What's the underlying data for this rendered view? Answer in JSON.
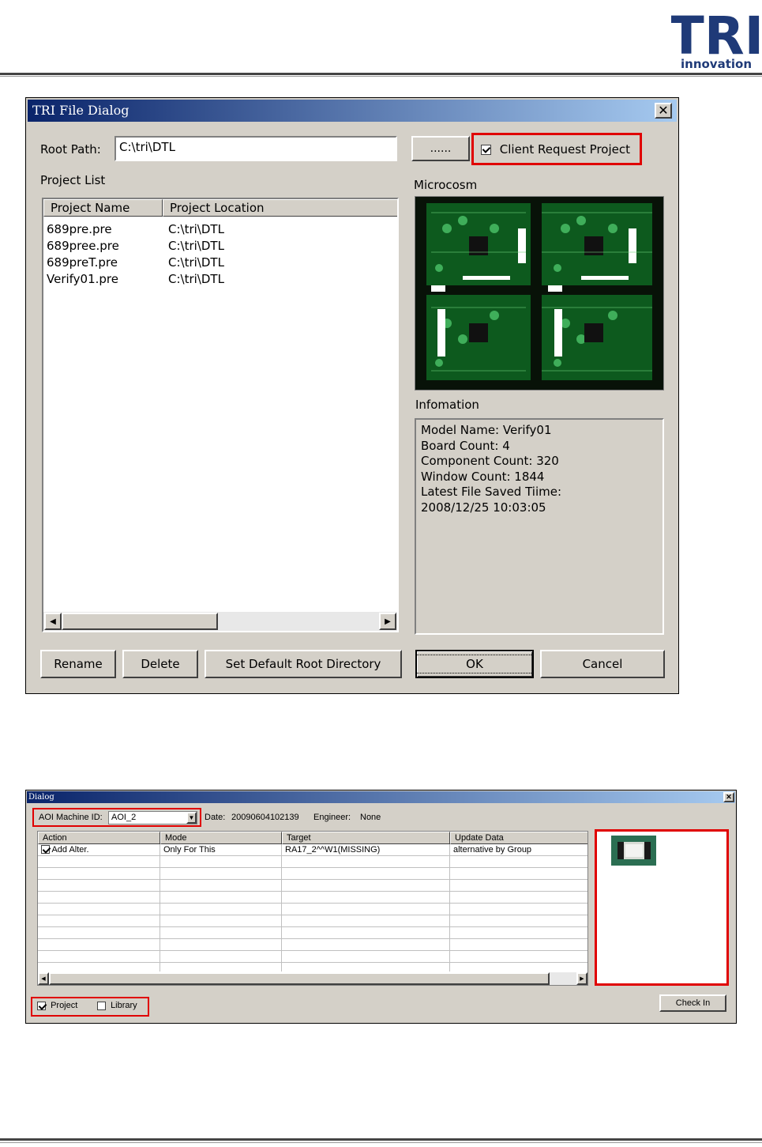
{
  "logo": {
    "main": "TRI",
    "sub": "innovation"
  },
  "dialog1": {
    "title": "TRI File Dialog",
    "root_path_label": "Root Path:",
    "root_path_value": "C:\\tri\\DTL",
    "browse_button": "......",
    "client_request_label": "Client Request Project",
    "client_request_checked": true,
    "project_list_label": "Project List",
    "columns": [
      "Project Name",
      "Project Location"
    ],
    "projects": [
      {
        "name": "689pre.pre",
        "location": "C:\\tri\\DTL"
      },
      {
        "name": "689pree.pre",
        "location": "C:\\tri\\DTL"
      },
      {
        "name": "689preT.pre",
        "location": "C:\\tri\\DTL"
      },
      {
        "name": "Verify01.pre",
        "location": "C:\\tri\\DTL"
      }
    ],
    "microcosm_label": "Microcosm",
    "information_label": "Infomation",
    "information_lines": [
      "Model Name: Verify01",
      "Board Count: 4",
      "Component Count: 320",
      "Window Count: 1844",
      "Latest File Saved Tiime:",
      "2008/12/25  10:03:05"
    ],
    "buttons": {
      "rename": "Rename",
      "delete": "Delete",
      "set_default": "Set Default Root Directory",
      "ok": "OK",
      "cancel": "Cancel"
    }
  },
  "dialog2": {
    "title": "Dialog",
    "aoi_label": "AOI Machine ID:",
    "aoi_value": "AOI_2",
    "date_label": "Date:",
    "date_value": "20090604102139",
    "engineer_label": "Engineer:",
    "engineer_value": "None",
    "columns": [
      "Action",
      "Mode",
      "Target",
      "Update Data"
    ],
    "rows": [
      {
        "action": "Add Alter.",
        "action_checked": true,
        "mode": "Only For This",
        "target": "RA17_2^^W1(MISSING)",
        "update": "alternative by Group"
      }
    ],
    "project_label": "Project",
    "project_checked": true,
    "library_label": "Library",
    "library_checked": false,
    "check_in_button": "Check In"
  },
  "colors": {
    "highlight_red": "#e00000",
    "title_blue": "#0a246a",
    "dialog_gray": "#d4d0c8"
  }
}
